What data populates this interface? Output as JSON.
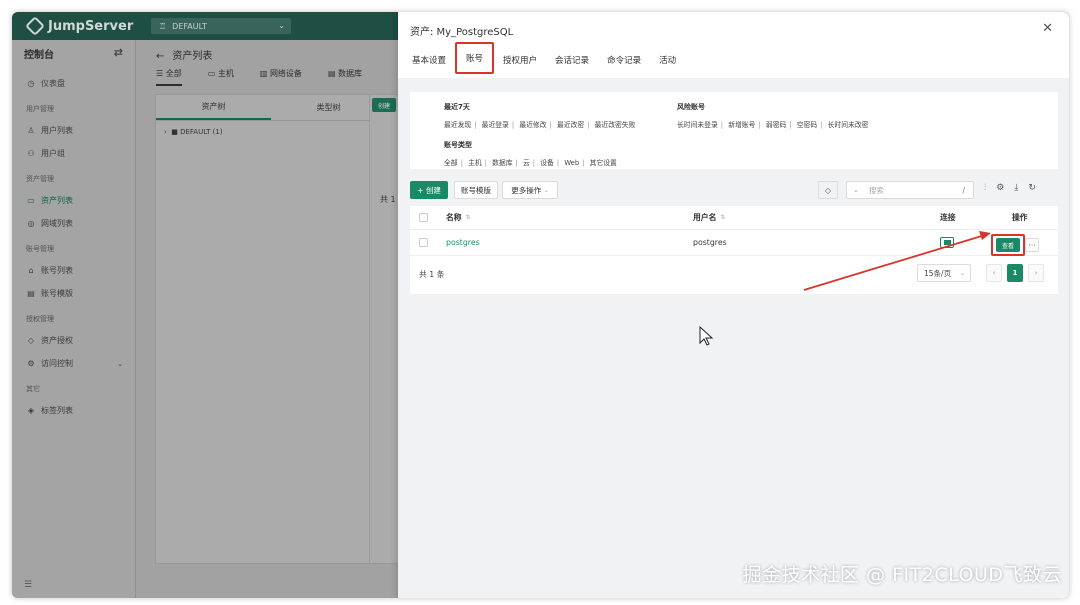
{
  "topbar": {
    "brand": "JumpServer",
    "org": "DEFAULT"
  },
  "sidebar": {
    "title": "控制台",
    "groups": [
      {
        "title": "",
        "items": [
          {
            "label": "仪表盘",
            "icon": "dashboard-icon"
          }
        ]
      },
      {
        "title": "用户管理",
        "items": [
          {
            "label": "用户列表",
            "icon": "user-icon"
          },
          {
            "label": "用户组",
            "icon": "users-icon"
          }
        ]
      },
      {
        "title": "资产管理",
        "items": [
          {
            "label": "资产列表",
            "icon": "asset-icon",
            "active": true
          },
          {
            "label": "网域列表",
            "icon": "domain-icon"
          }
        ]
      },
      {
        "title": "账号管理",
        "items": [
          {
            "label": "账号列表",
            "icon": "lock-icon"
          },
          {
            "label": "账号模版",
            "icon": "template-icon"
          }
        ]
      },
      {
        "title": "授权管理",
        "items": [
          {
            "label": "资产授权",
            "icon": "shield-icon"
          },
          {
            "label": "访问控制",
            "icon": "control-icon",
            "expandable": true
          }
        ]
      },
      {
        "title": "其它",
        "items": [
          {
            "label": "标签列表",
            "icon": "tag-icon"
          }
        ]
      }
    ]
  },
  "background": {
    "title": "资产列表",
    "tabs": [
      "全部",
      "主机",
      "网络设备",
      "数据库"
    ],
    "panel_tabs": [
      "资产树",
      "类型树"
    ],
    "tree_node": "DEFAULT (1)",
    "create_label": "创建",
    "total": "共 1"
  },
  "drawer": {
    "title": "资产: My_PostgreSQL",
    "tabs": [
      "基本设置",
      "账号",
      "授权用户",
      "会话记录",
      "命令记录",
      "活动"
    ],
    "active_tab": "账号",
    "filters": {
      "recent": {
        "label": "最近7天",
        "links": [
          "最近发现",
          "最近登录",
          "最近修改",
          "最近改密",
          "最近改密失败"
        ]
      },
      "risk": {
        "label": "风险账号",
        "links": [
          "长时间未登录",
          "新增账号",
          "弱密码",
          "空密码",
          "长时间未改密"
        ]
      },
      "type": {
        "label": "账号类型",
        "links": [
          "全部",
          "主机",
          "数据库",
          "云",
          "设备",
          "Web",
          "其它设置"
        ]
      }
    },
    "toolbar": {
      "create": "+ 创建",
      "template": "账号模版",
      "more": "更多操作",
      "search_placeholder": "搜索",
      "search_hint": "/"
    },
    "table": {
      "columns": {
        "name": "名称",
        "username": "用户名",
        "connect": "连接",
        "actions": "操作"
      },
      "rows": [
        {
          "name": "postgres",
          "username": "postgres"
        }
      ],
      "view_label": "查看",
      "more_label": "···"
    },
    "footer": {
      "total": "共 1 条",
      "page_size": "15条/页",
      "current_page": "1"
    }
  },
  "watermark": "掘金技术社区 @ FIT2CLOUD飞致云",
  "colors": {
    "brand": "#1e4f42",
    "accent": "#1a8a66",
    "highlight": "#d8352a"
  }
}
